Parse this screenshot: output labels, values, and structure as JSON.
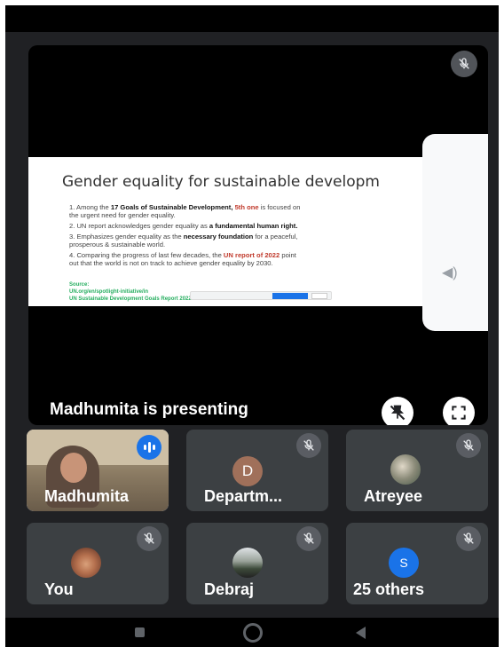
{
  "meeting": {
    "presenter_label": "Madhumita is presenting"
  },
  "slide": {
    "title": "Gender equality for sustainable developm",
    "points": [
      {
        "pre": "1.  Among the ",
        "bold1": "17 Goals of Sustainable Development, ",
        "red": "5th one",
        "post": " is focused on",
        "line2": "the urgent need for gender equality."
      },
      {
        "pre": "2. UN report acknowledges gender equality as ",
        "bold1": "a fundamental human right.",
        "red": "",
        "post": "",
        "line2": ""
      },
      {
        "pre": "3. Emphasizes gender equality as the ",
        "bold1": "necessary foundation",
        "red": "",
        "post": " for a peaceful,",
        "line2": "prosperous & sustainable world."
      },
      {
        "pre": "4. Comparing the progress of last few decades, the ",
        "bold1": "",
        "red": "UN report of 2022",
        "post": " point",
        "line2": "out that the world is not on track to achieve gender equality by 2030."
      }
    ],
    "source_label": "Source:",
    "source_links": [
      "UN.org/en/spotlight-initiative/in",
      "UN Sustainable Development Goals Report 2022"
    ]
  },
  "participants": [
    {
      "name": "Madhumita",
      "type": "video",
      "speaking": true
    },
    {
      "name": "Departm...",
      "type": "initial",
      "initial": "D",
      "color": "#a0705a",
      "muted": true
    },
    {
      "name": "Atreyee",
      "type": "photo",
      "muted": true
    },
    {
      "name": "You",
      "type": "photo",
      "muted": true
    },
    {
      "name": "Debraj",
      "type": "photo",
      "muted": true
    },
    {
      "name": "25 others",
      "type": "initial",
      "initial": "S",
      "color": "#1a73e8",
      "muted": true
    }
  ],
  "colors": {
    "background": "#202124",
    "tile": "#3c4043",
    "accent": "#1a73e8",
    "speaking_ring": "#8ab4f8"
  },
  "icons": {
    "mic_off": "mic-off-icon",
    "pin": "unpin-icon",
    "fullscreen": "fullscreen-icon",
    "speaking": "audio-level-icon"
  }
}
